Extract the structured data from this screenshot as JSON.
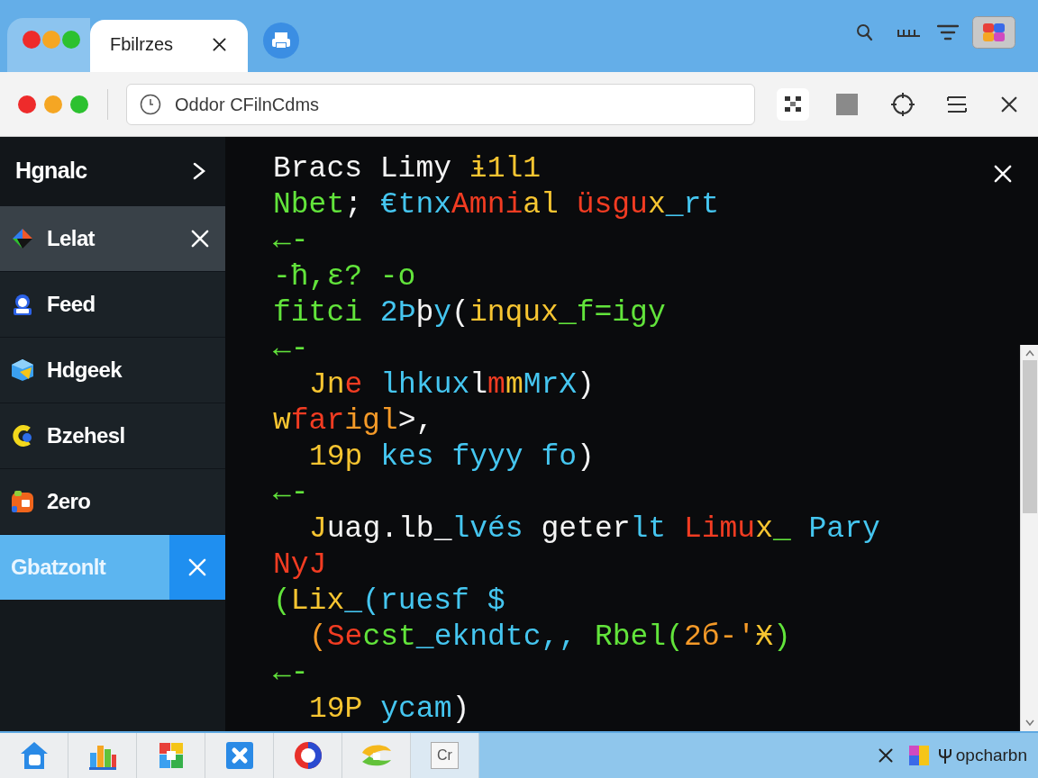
{
  "title_bar": {
    "tab": {
      "title": "Fbilrzes"
    }
  },
  "toolbar": {
    "address": {
      "value": "Oddor CFilnCdms"
    }
  },
  "sidebar": {
    "header": {
      "label": "Hgnalc"
    },
    "items": [
      {
        "label": "Lelat",
        "selected": false,
        "hovered": true
      },
      {
        "label": "Feed",
        "selected": false,
        "hovered": false
      },
      {
        "label": "Hdgeek",
        "selected": false,
        "hovered": false
      },
      {
        "label": "Bzehesl",
        "selected": false,
        "hovered": false
      },
      {
        "label": "2ero",
        "selected": false,
        "hovered": false
      },
      {
        "label": "Gbatzonlt",
        "selected": true,
        "hovered": false
      }
    ]
  },
  "editor": {
    "lines": [
      {
        "indented": false,
        "segments": [
          {
            "text": "Bracs Limy ",
            "color": "#f4f4f4"
          },
          {
            "text": "ɨ1l1",
            "color": "#f7c531"
          }
        ]
      },
      {
        "indented": false,
        "segments": [
          {
            "text": "Nbet",
            "color": "#62e43b"
          },
          {
            "text": "; ",
            "color": "#f4f4f4"
          },
          {
            "text": "€tnx",
            "color": "#45c6f0"
          },
          {
            "text": "Amni",
            "color": "#f23c22"
          },
          {
            "text": "al ",
            "color": "#f7c531"
          },
          {
            "text": "üsgu",
            "color": "#f23c22"
          },
          {
            "text": "x",
            "color": "#f7c531"
          },
          {
            "text": "_rt",
            "color": "#45c6f0"
          }
        ]
      },
      {
        "indented": false,
        "segments": [
          {
            "text": "←-",
            "color": "#62e43b"
          }
        ]
      },
      {
        "indented": false,
        "segments": [
          {
            "text": "-ħ,ε? -o",
            "color": "#62e43b"
          }
        ]
      },
      {
        "indented": false,
        "segments": [
          {
            "text": "fitci ",
            "color": "#62e43b"
          },
          {
            "text": "2Þ",
            "color": "#45c6f0"
          },
          {
            "text": "þ",
            "color": "#f4f4f4"
          },
          {
            "text": "y",
            "color": "#45c6f0"
          },
          {
            "text": "(",
            "color": "#f4f4f4"
          },
          {
            "text": "inqux",
            "color": "#f7c531"
          },
          {
            "text": "_f=igy",
            "color": "#62e43b"
          }
        ]
      },
      {
        "indented": false,
        "segments": [
          {
            "text": "←-",
            "color": "#62e43b"
          }
        ]
      },
      {
        "indented": true,
        "segments": [
          {
            "text": "Jn",
            "color": "#f7c531"
          },
          {
            "text": "e ",
            "color": "#f23c22"
          },
          {
            "text": "lhkux",
            "color": "#45c6f0"
          },
          {
            "text": "l",
            "color": "#f4f4f4"
          },
          {
            "text": "m",
            "color": "#f23c22"
          },
          {
            "text": "m",
            "color": "#f7c531"
          },
          {
            "text": "MrX",
            "color": "#45c6f0"
          },
          {
            "text": ")",
            "color": "#f4f4f4"
          }
        ]
      },
      {
        "indented": false,
        "segments": [
          {
            "text": "w",
            "color": "#f7c531"
          },
          {
            "text": "far",
            "color": "#f23c22"
          },
          {
            "text": "igl",
            "color": "#f59a28"
          },
          {
            "text": ">,",
            "color": "#f4f4f4"
          }
        ]
      },
      {
        "indented": true,
        "segments": [
          {
            "text": "19p ",
            "color": "#f7c531"
          },
          {
            "text": "kes fyyy fo",
            "color": "#45c6f0"
          },
          {
            "text": ")",
            "color": "#f4f4f4"
          }
        ]
      },
      {
        "indented": false,
        "segments": [
          {
            "text": "←-",
            "color": "#62e43b"
          }
        ]
      },
      {
        "indented": true,
        "segments": [
          {
            "text": "J",
            "color": "#f7c531"
          },
          {
            "text": "uag.lb_",
            "color": "#f4f4f4"
          },
          {
            "text": "lvés ",
            "color": "#45c6f0"
          },
          {
            "text": "geter",
            "color": "#f4f4f4"
          },
          {
            "text": "lt ",
            "color": "#45c6f0"
          },
          {
            "text": "Limu",
            "color": "#f23c22"
          },
          {
            "text": "x",
            "color": "#f7c531"
          },
          {
            "text": "_ ",
            "color": "#62e43b"
          },
          {
            "text": "Pary",
            "color": "#45c6f0"
          }
        ]
      },
      {
        "indented": false,
        "segments": [
          {
            "text": "NyJ",
            "color": "#f23c22"
          }
        ]
      },
      {
        "indented": false,
        "segments": [
          {
            "text": "(",
            "color": "#62e43b"
          },
          {
            "text": "Lix",
            "color": "#f7c531"
          },
          {
            "text": "_(ruesf $",
            "color": "#45c6f0"
          }
        ]
      },
      {
        "indented": true,
        "segments": [
          {
            "text": "(",
            "color": "#f59a28"
          },
          {
            "text": "Se",
            "color": "#f23c22"
          },
          {
            "text": "cst",
            "color": "#62e43b"
          },
          {
            "text": "_ekndtc,, ",
            "color": "#45c6f0"
          },
          {
            "text": "Rbel(",
            "color": "#62e43b"
          },
          {
            "text": "2б-'",
            "color": "#f59a28"
          },
          {
            "text": "Ӿ",
            "color": "#f7c531"
          },
          {
            "text": ")",
            "color": "#62e43b"
          }
        ]
      },
      {
        "indented": false,
        "segments": [
          {
            "text": "←-",
            "color": "#62e43b"
          }
        ]
      },
      {
        "indented": true,
        "segments": [
          {
            "text": "19P ",
            "color": "#f7c531"
          },
          {
            "text": "ycam",
            "color": "#45c6f0"
          },
          {
            "text": ")",
            "color": "#f4f4f4"
          }
        ]
      }
    ]
  },
  "taskbar": {
    "label_tile": {
      "label": "Cr"
    },
    "tray": {
      "text": "opcharbn"
    }
  }
}
